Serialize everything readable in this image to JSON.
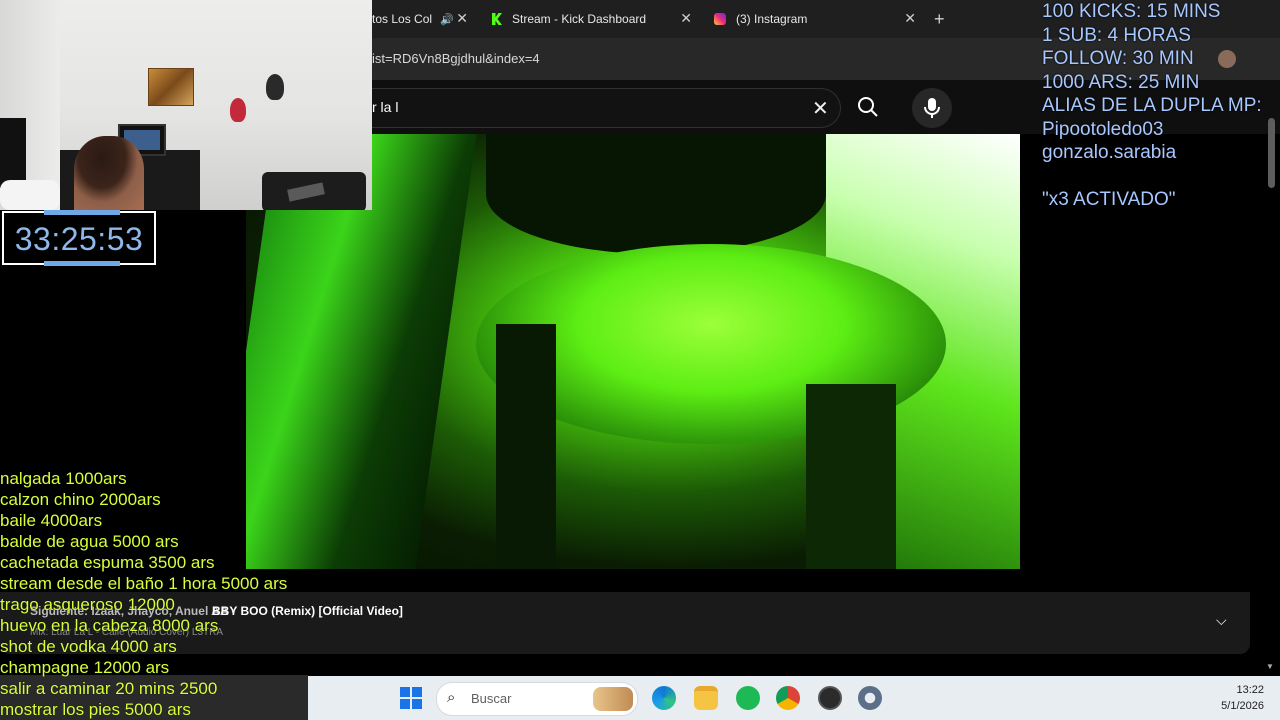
{
  "browser": {
    "tabs": [
      {
        "title": "tos Los Col"
      },
      {
        "title": "Stream - Kick Dashboard"
      },
      {
        "title": "(3) Instagram"
      }
    ],
    "new_tab": "+",
    "url": "ist=RD6Vn8Bgjdhul&index=4"
  },
  "youtube": {
    "search_value": "r la l",
    "up_next_label": "Siguiente: Izaak, Jhayco, Anuel AA -",
    "up_next_title": "BBY BOO (Remix) [Official Video]",
    "mix_line": "Mix: Luar La L - Calle (Audio Cover) L3TRA"
  },
  "stream_overlay": {
    "timer": "33:25:53",
    "price_list": [
      "nalgada 1000ars",
      "calzon chino 2000ars",
      "baile 4000ars",
      "balde de agua 5000 ars",
      "cachetada espuma 3500 ars",
      "stream desde el baño 1 hora 5000 ars",
      "trago asqueroso 12000",
      "huevo en la cabeza 8000 ars",
      "shot de vodka 4000 ars",
      "champagne 12000 ars",
      "salir a caminar 20 mins 2500",
      "mostrar los pies 5000 ars"
    ],
    "goals": [
      "100 KICKS: 15 MINS",
      "1 SUB: 4 HORAS",
      "FOLLOW: 30 MIN",
      "1000 ARS: 25 MIN",
      "ALIAS DE LA DUPLA MP:",
      "Pipootoledo03",
      "gonzalo.sarabia"
    ],
    "multiplier": "\"x3 ACTIVADO\""
  },
  "taskbar": {
    "search_placeholder": "Buscar",
    "time": "13:22",
    "date": "5/1/2026",
    "apps": [
      "edge-icon",
      "file-explorer-icon",
      "spotify-icon",
      "chrome-icon",
      "obs-icon",
      "settings-icon"
    ]
  },
  "colors": {
    "timer": "#8fb8ea",
    "price_list": "#d7ff3a",
    "goals": "#a7c7ff"
  }
}
